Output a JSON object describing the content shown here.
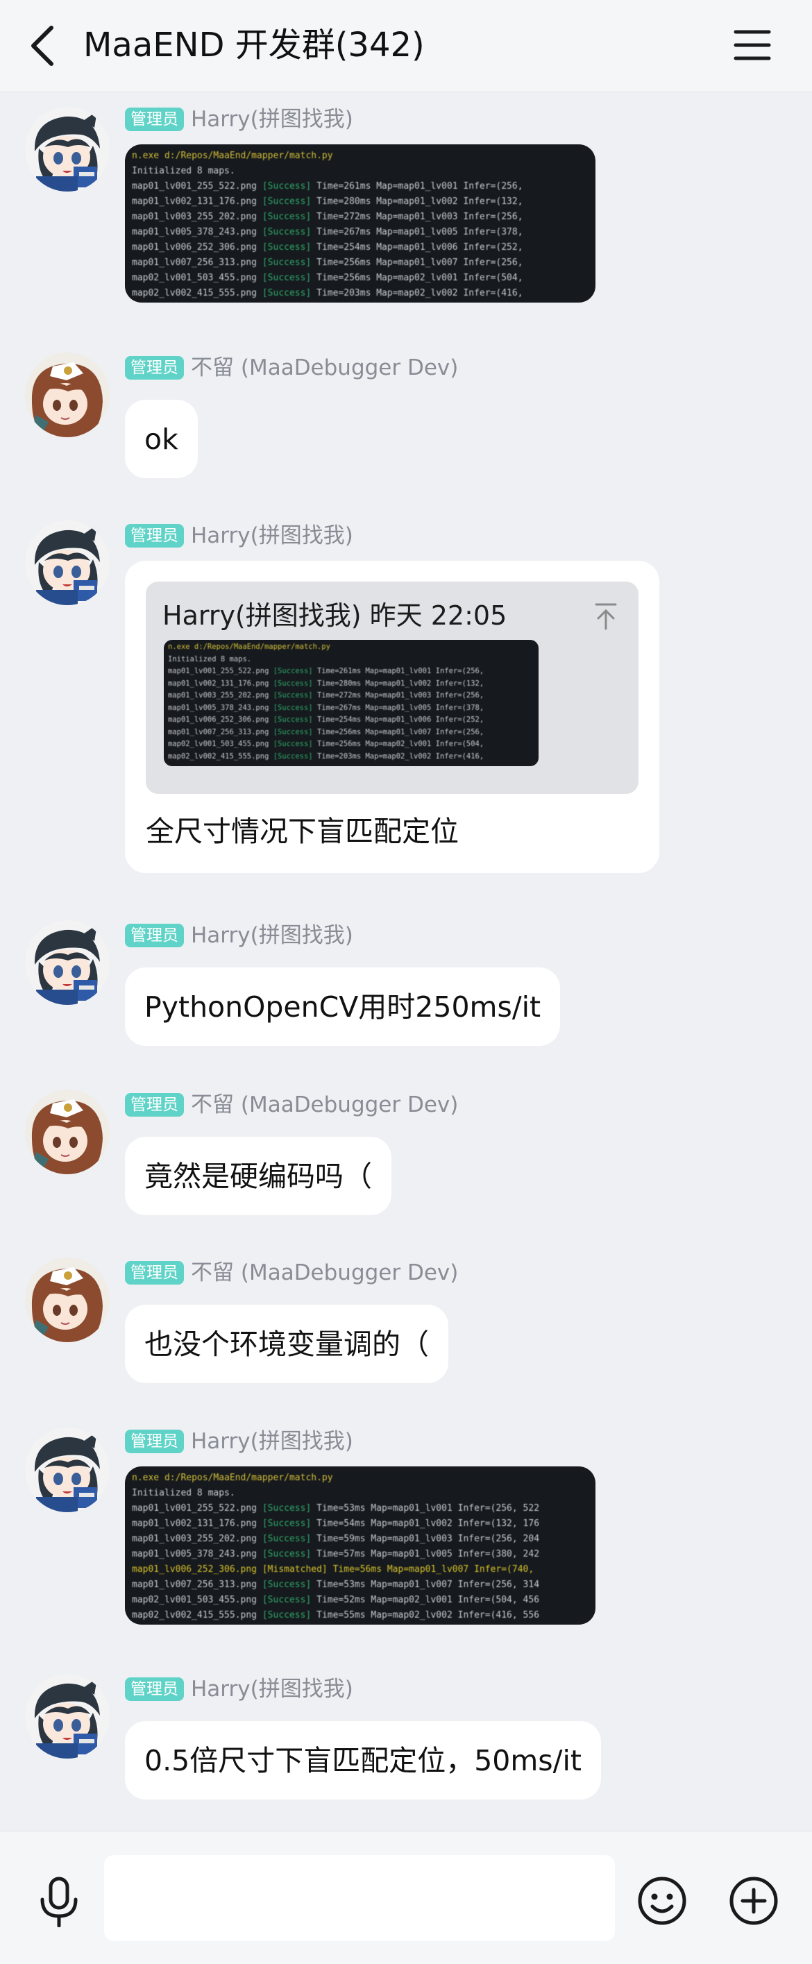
{
  "header": {
    "title": "MaaEND 开发群(342)"
  },
  "messages": [
    {
      "role": "管理员",
      "nick": "Harry(拼图找我)",
      "terminal": {
        "path": "n.exe d:/Repos/MaaEnd/mapper/match.py",
        "lines": [
          "Initialized 8 maps.",
          "map01_lv001_255_522.png [Success] Time=261ms Map=map01_lv001 Infer=(256,",
          "map01_lv002_131_176.png [Success] Time=280ms Map=map01_lv002 Infer=(132,",
          "map01_lv003_255_202.png [Success] Time=272ms Map=map01_lv003 Infer=(256,",
          "map01_lv005_378_243.png [Success] Time=267ms Map=map01_lv005 Infer=(378,",
          "map01_lv006_252_306.png [Success] Time=254ms Map=map01_lv006 Infer=(252,",
          "map01_lv007_256_313.png [Success] Time=256ms Map=map01_lv007 Infer=(256,",
          "map02_lv001_503_455.png [Success] Time=256ms Map=map02_lv001 Infer=(504,",
          "map02_lv002_415_555.png [Success] Time=203ms Map=map02_lv002 Infer=(416,"
        ]
      }
    },
    {
      "role": "管理员",
      "nick": "不留 (MaaDebugger Dev)",
      "text": "ok"
    },
    {
      "role": "管理员",
      "nick": "Harry(拼图找我)",
      "quote": {
        "author_time": "Harry(拼图找我) 昨天 22:05"
      },
      "text": "全尺寸情况下盲匹配定位"
    },
    {
      "role": "管理员",
      "nick": "Harry(拼图找我)",
      "text": "PythonOpenCV用时250ms/it"
    },
    {
      "role": "管理员",
      "nick": "不留 (MaaDebugger Dev)",
      "text": "竟然是硬编码吗（"
    },
    {
      "role": "管理员",
      "nick": "不留 (MaaDebugger Dev)",
      "text": "也没个环境变量调的（"
    },
    {
      "role": "管理员",
      "nick": "Harry(拼图找我)",
      "terminal": {
        "path": "n.exe d:/Repos/MaaEnd/mapper/match.py",
        "lines": [
          "Initialized 8 maps.",
          "map01_lv001_255_522.png [Success] Time=53ms Map=map01_lv001 Infer=(256, 522",
          "map01_lv002_131_176.png [Success] Time=54ms Map=map01_lv002 Infer=(132, 176",
          "map01_lv003_255_202.png [Success] Time=59ms Map=map01_lv003 Infer=(256, 204",
          "map01_lv005_378_243.png [Success] Time=57ms Map=map01_lv005 Infer=(380, 242",
          "map01_lv006_252_306.png [Mismatched] Time=56ms Map=map01_lv007 Infer=(740,",
          "map01_lv007_256_313.png [Success] Time=53ms Map=map01_lv007 Infer=(256, 314",
          "map02_lv001_503_455.png [Success] Time=52ms Map=map02_lv001 Infer=(504, 456",
          "map02_lv002_415_555.png [Success] Time=55ms Map=map02_lv002 Infer=(416, 556"
        ]
      }
    },
    {
      "role": "管理员",
      "nick": "Harry(拼图找我)",
      "text": "0.5倍尺寸下盲匹配定位，50ms/it"
    }
  ]
}
